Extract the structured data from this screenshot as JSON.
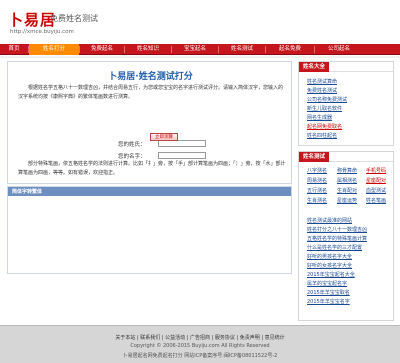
{
  "header": {
    "logo": "卜易居",
    "tagline": "免费姓名测试",
    "domain": "http://xmce.buyiju.com"
  },
  "nav": {
    "items": [
      "首页",
      "姓名打分",
      "免费起名",
      "姓名知识",
      "宝宝起名",
      "姓名测试",
      "起名免费",
      "公司起名"
    ],
    "active_index": 1
  },
  "main": {
    "title": "卜易居·姓名测试打分",
    "intro": "根据姓名学五格八十一数理吉凶，并结合周易五行，为您或您宝宝的名字进行测试评分。请输入简体汉字，您输入的汉字系统均按《康熙字典》的繁体笔画数进行测算。",
    "surname_label": "您的姓氏：",
    "surname_value": "",
    "name_label": "您的名字：",
    "name_value": "",
    "submit_label": "立即测算",
    "hint": "部分特殊笔画，依五格姓名学的法则进行计算。比如「扌」旁，按「手」部计算笔画为四画；「氵」旁，按「水」部计算笔画为四画，等等。如有错误，欢迎指正。"
  },
  "result": {
    "title": "简体字转繁体"
  },
  "sidebar1": {
    "title": "姓名大全",
    "links": [
      "姓名测试算命",
      "免费姓名测试",
      "公司名称免费测试",
      "新生儿取名软件",
      "网名生成器",
      "起名网免费取名",
      "姓名四柱起名"
    ]
  },
  "sidebar2": {
    "title": "姓名测试",
    "grid": [
      [
        "八字测名",
        "称骨算命",
        "手机号码"
      ],
      [
        "周易测名",
        "属相测名",
        "星座配对"
      ],
      [
        "五行测名",
        "生肖配对",
        "血型测试"
      ],
      [
        "生肖测名",
        "星座运势",
        "姓名笔画"
      ]
    ],
    "links": [
      "姓名测试最准的网站",
      "姓名打分之八十一数理吉凶",
      "五格姓名学的特殊笔画计算",
      "什么是姓名学的三才配置",
      "好听的男孩名字大全",
      "好听的女孩名字大全",
      "2015年宝宝起名大全",
      "属羊的宝宝起名字",
      "2015年羊宝宝取名",
      "2015年羊宝宝名字"
    ]
  },
  "footer": {
    "links": "关于本站 | 联系我们 | 公益活动 | 广告招商 | 服务协议 | 免责声明 | 意见统计",
    "copyright": "Copyright © 2006-2015 Buyiju.com All Rights Reserved",
    "icp": "卜易居起名网免费起名打分 网站ICP备案序号:闽ICP备08011522号-2"
  }
}
